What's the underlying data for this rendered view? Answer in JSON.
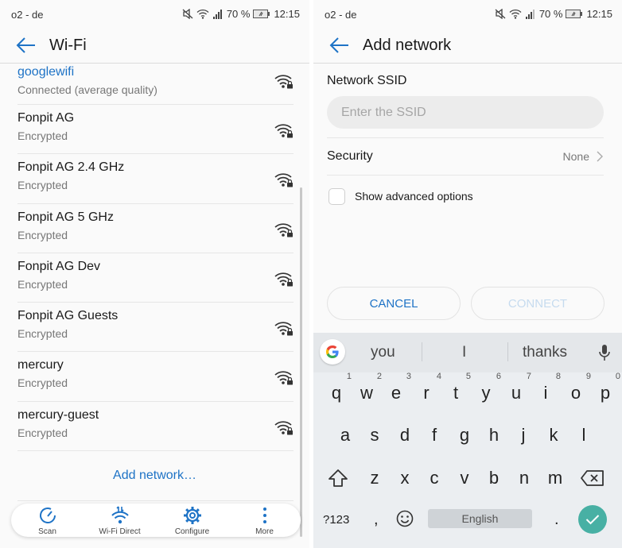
{
  "status_bar": {
    "carrier": "o2 - de",
    "battery_percent": "70 %",
    "time": "12:15",
    "icons": [
      "mute-icon",
      "wifi-icon",
      "signal-icon",
      "battery-icon"
    ]
  },
  "left_screen": {
    "title": "Wi-Fi",
    "networks": [
      {
        "name": "googlewifi",
        "status": "Connected (average quality)",
        "connected": true
      },
      {
        "name": "Fonpit AG",
        "status": "Encrypted"
      },
      {
        "name": "Fonpit AG 2.4 GHz",
        "status": "Encrypted"
      },
      {
        "name": "Fonpit AG 5 GHz",
        "status": "Encrypted"
      },
      {
        "name": "Fonpit AG Dev",
        "status": "Encrypted"
      },
      {
        "name": "Fonpit AG Guests",
        "status": "Encrypted"
      },
      {
        "name": "mercury",
        "status": "Encrypted"
      },
      {
        "name": "mercury-guest",
        "status": "Encrypted"
      }
    ],
    "add_network_label": "Add network…",
    "bottom_bar": [
      {
        "label": "Scan",
        "icon": "scan-icon"
      },
      {
        "label": "Wi-Fi Direct",
        "icon": "wifi-direct-icon"
      },
      {
        "label": "Configure",
        "icon": "gear-icon"
      },
      {
        "label": "More",
        "icon": "more-vertical-icon"
      }
    ]
  },
  "right_screen": {
    "title": "Add network",
    "ssid_label": "Network SSID",
    "ssid_value": "",
    "ssid_placeholder": "Enter the SSID",
    "security_label": "Security",
    "security_value": "None",
    "advanced_label": "Show advanced options",
    "advanced_checked": false,
    "cancel_label": "CANCEL",
    "connect_label": "CONNECT"
  },
  "keyboard": {
    "suggestions": [
      "you",
      "I",
      "thanks"
    ],
    "row1": [
      {
        "key": "q",
        "num": "1"
      },
      {
        "key": "w",
        "num": "2"
      },
      {
        "key": "e",
        "num": "3"
      },
      {
        "key": "r",
        "num": "4"
      },
      {
        "key": "t",
        "num": "5"
      },
      {
        "key": "y",
        "num": "6"
      },
      {
        "key": "u",
        "num": "7"
      },
      {
        "key": "i",
        "num": "8"
      },
      {
        "key": "o",
        "num": "9"
      },
      {
        "key": "p",
        "num": "0"
      }
    ],
    "row2": [
      "a",
      "s",
      "d",
      "f",
      "g",
      "h",
      "j",
      "k",
      "l"
    ],
    "row3": [
      "z",
      "x",
      "c",
      "v",
      "b",
      "n",
      "m"
    ],
    "symbols_label": "?123",
    "comma": ",",
    "space_label": "English",
    "period": ".",
    "accent_color": "#48b0a4"
  },
  "colors": {
    "accent_blue": "#1e73c6",
    "disabled_blue": "#c6dbef"
  }
}
